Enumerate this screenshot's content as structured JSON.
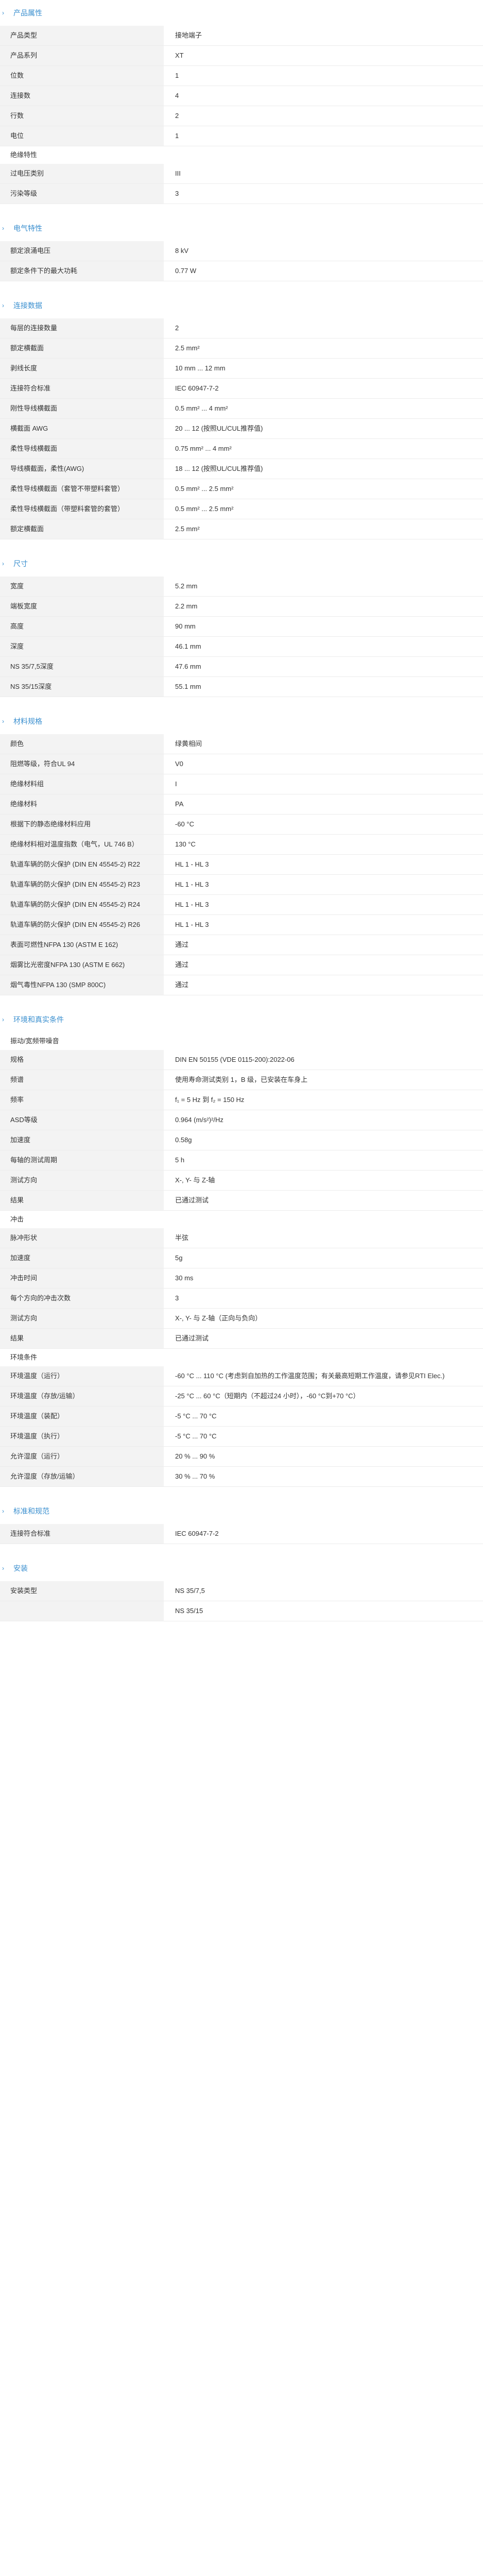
{
  "sections": [
    {
      "title": "产品属性",
      "groups": [
        {
          "heading": "",
          "rows": [
            {
              "k": "产品类型",
              "v": "接地端子"
            },
            {
              "k": "产品系列",
              "v": "XT"
            },
            {
              "k": "位数",
              "v": "1"
            },
            {
              "k": "连接数",
              "v": "4"
            },
            {
              "k": "行数",
              "v": "2"
            },
            {
              "k": "电位",
              "v": "1"
            }
          ]
        },
        {
          "heading": "绝缘特性",
          "rows": [
            {
              "k": "过电压类别",
              "v": "III"
            },
            {
              "k": "污染等级",
              "v": "3"
            }
          ]
        }
      ]
    },
    {
      "title": "电气特性",
      "groups": [
        {
          "heading": "",
          "rows": [
            {
              "k": "额定浪涌电压",
              "v": "8 kV"
            },
            {
              "k": "额定条件下的最大功耗",
              "v": "0.77 W"
            }
          ]
        }
      ]
    },
    {
      "title": "连接数据",
      "groups": [
        {
          "heading": "",
          "rows": [
            {
              "k": "每层的连接数量",
              "v": "2"
            },
            {
              "k": "额定横截面",
              "v": "2.5 mm²"
            },
            {
              "k": "剥线长度",
              "v": "10 mm ... 12 mm"
            },
            {
              "k": "连接符合标准",
              "v": "IEC 60947-7-2"
            },
            {
              "k": "刚性导线横截面",
              "v": "0.5 mm² ... 4 mm²"
            },
            {
              "k": "横截面 AWG",
              "v": "20 ... 12 (按照UL/CUL推荐值)"
            },
            {
              "k": "柔性导线横截面",
              "v": "0.75 mm² ... 4 mm²"
            },
            {
              "k": "导线横截面，柔性(AWG)",
              "v": "18 ... 12 (按照UL/CUL推荐值)"
            },
            {
              "k": "柔性导线横截面（套管不带塑料套管）",
              "v": "0.5 mm² ... 2.5 mm²"
            },
            {
              "k": "柔性导线横截面（带塑料套管的套管）",
              "v": "0.5 mm² ... 2.5 mm²"
            },
            {
              "k": "额定横截面",
              "v": "2.5 mm²"
            }
          ]
        }
      ]
    },
    {
      "title": "尺寸",
      "groups": [
        {
          "heading": "",
          "rows": [
            {
              "k": "宽度",
              "v": "5.2 mm"
            },
            {
              "k": "端板宽度",
              "v": "2.2 mm"
            },
            {
              "k": "高度",
              "v": "90 mm"
            },
            {
              "k": "深度",
              "v": "46.1 mm"
            },
            {
              "k": "NS 35/7,5深度",
              "v": "47.6 mm"
            },
            {
              "k": "NS 35/15深度",
              "v": "55.1 mm"
            }
          ]
        }
      ]
    },
    {
      "title": "材料规格",
      "groups": [
        {
          "heading": "",
          "rows": [
            {
              "k": "颜色",
              "v": "绿黄相间"
            },
            {
              "k": "阻燃等级，符合UL 94",
              "v": "V0"
            },
            {
              "k": "绝缘材料组",
              "v": "I"
            },
            {
              "k": "绝缘材料",
              "v": "PA"
            },
            {
              "k": "根据下的静态绝缘材料应用",
              "v": "-60 °C"
            },
            {
              "k": "绝缘材料相对温度指数（电气，UL 746 B）",
              "v": "130 °C"
            },
            {
              "k": "轨道车辆的防火保护 (DIN EN 45545-2) R22",
              "v": "HL 1 - HL 3"
            },
            {
              "k": "轨道车辆的防火保护 (DIN EN 45545-2) R23",
              "v": "HL 1 - HL 3"
            },
            {
              "k": "轨道车辆的防火保护 (DIN EN 45545-2) R24",
              "v": "HL 1 - HL 3"
            },
            {
              "k": "轨道车辆的防火保护 (DIN EN 45545-2) R26",
              "v": "HL 1 - HL 3"
            },
            {
              "k": "表面可燃性NFPA 130 (ASTM E 162)",
              "v": "通过"
            },
            {
              "k": "烟雾比光密度NFPA 130 (ASTM E 662)",
              "v": "通过"
            },
            {
              "k": "烟气毒性NFPA 130 (SMP 800C)",
              "v": "通过"
            }
          ]
        }
      ]
    },
    {
      "title": "环境和真实条件",
      "groups": [
        {
          "heading": "振动/宽频带噪音",
          "rows": [
            {
              "k": "规格",
              "v": "DIN EN 50155 (VDE 0115-200):2022-06"
            },
            {
              "k": "频谱",
              "v": "使用寿命测试类别 1，B 级，已安装在车身上"
            },
            {
              "k": "频率",
              "v": "f₁ = 5 Hz 到 f₂ = 150 Hz"
            },
            {
              "k": "ASD等级",
              "v": "0.964 (m/s²)²/Hz"
            },
            {
              "k": "加速度",
              "v": "0.58g"
            },
            {
              "k": "每轴的测试周期",
              "v": "5 h"
            },
            {
              "k": "测试方向",
              "v": "X-, Y- 与 Z-轴"
            },
            {
              "k": "结果",
              "v": "已通过测试"
            }
          ]
        },
        {
          "heading": "冲击",
          "rows": [
            {
              "k": "脉冲形状",
              "v": "半弦"
            },
            {
              "k": "加速度",
              "v": "5g"
            },
            {
              "k": "冲击时间",
              "v": "30 ms"
            },
            {
              "k": "每个方向的冲击次数",
              "v": "3"
            },
            {
              "k": "测试方向",
              "v": "X-, Y- 与 Z-轴（正向与负向）"
            },
            {
              "k": "结果",
              "v": "已通过测试"
            }
          ]
        },
        {
          "heading": "环境条件",
          "rows": [
            {
              "k": "环境温度（运行）",
              "v": "-60 °C ... 110 °C (考虑到自加热的工作温度范围；有关最高短期工作温度，请参见RTI Elec.)"
            },
            {
              "k": "环境温度（存放/运输）",
              "v": "-25 °C ... 60 °C（短期内（不超过24 小时），-60 °C到+70 °C）"
            },
            {
              "k": "环境温度（装配）",
              "v": "-5 °C ... 70 °C"
            },
            {
              "k": "环境温度（执行）",
              "v": "-5 °C ... 70 °C"
            },
            {
              "k": "允许湿度（运行）",
              "v": "20 % ... 90 %"
            },
            {
              "k": "允许湿度（存放/运输）",
              "v": "30 % ... 70 %"
            }
          ]
        }
      ]
    },
    {
      "title": "标准和规范",
      "groups": [
        {
          "heading": "",
          "rows": [
            {
              "k": "连接符合标准",
              "v": "IEC 60947-7-2"
            }
          ]
        }
      ]
    },
    {
      "title": "安装",
      "groups": [
        {
          "heading": "",
          "rows": [
            {
              "k": "安装类型",
              "v": "NS 35/7,5"
            },
            {
              "k": "",
              "v": "NS 35/15"
            }
          ]
        }
      ]
    }
  ]
}
